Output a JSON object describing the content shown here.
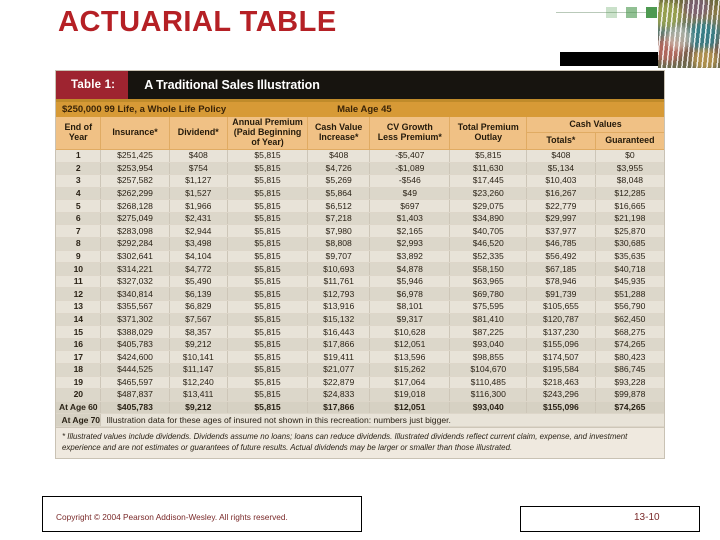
{
  "slide": {
    "title": "ACTUARIAL TABLE",
    "title_color": "#b52025",
    "copyright": "Copyright © 2004 Pearson Addison-Wesley. All rights reserved.",
    "page_number": "13-10"
  },
  "decoration": {
    "squares_color": "#4e9a51",
    "square_count": 3
  },
  "table": {
    "badge": "Table 1:",
    "caption": "A Traditional Sales Illustration",
    "badge_color": "#9e2430",
    "subbar_color": "#d79a36",
    "header_color": "#f0c185",
    "policy": "$250,000 99 Life, a Whole Life Policy",
    "insured": "Male Age 45",
    "columns": [
      "End of Year",
      "Insurance*",
      "Dividend*",
      "Annual Premium (Paid Beginning of Year)",
      "Cash Value Increase*",
      "CV Growth Less Premium*",
      "Total Premium Outlay",
      "Cash Values"
    ],
    "headers": {
      "end_of_year": [
        "End of",
        "Year"
      ],
      "insurance": "Insurance*",
      "dividend": "Dividend*",
      "annual_premium": [
        "Annual Premium",
        "(Paid Beginning",
        "of Year)"
      ],
      "cash_value_increase": [
        "Cash Value",
        "Increase*"
      ],
      "cv_growth": [
        "CV Growth",
        "Less Premium*"
      ],
      "total_premium_outlay": [
        "Total Premium",
        "Outlay"
      ],
      "cash_values_group": "Cash Values",
      "cash_values_totals": "Totals*",
      "cash_values_guaranteed": "Guaranteed"
    },
    "rows": [
      [
        "1",
        "$251,425",
        "$408",
        "$5,815",
        "$408",
        "-$5,407",
        "$5,815",
        "$408",
        "$0"
      ],
      [
        "2",
        "$253,954",
        "$754",
        "$5,815",
        "$4,726",
        "-$1,089",
        "$11,630",
        "$5,134",
        "$3,955"
      ],
      [
        "3",
        "$257,582",
        "$1,127",
        "$5,815",
        "$5,269",
        "-$546",
        "$17,445",
        "$10,403",
        "$8,048"
      ],
      [
        "4",
        "$262,299",
        "$1,527",
        "$5,815",
        "$5,864",
        "$49",
        "$23,260",
        "$16,267",
        "$12,285"
      ],
      [
        "5",
        "$268,128",
        "$1,966",
        "$5,815",
        "$6,512",
        "$697",
        "$29,075",
        "$22,779",
        "$16,665"
      ],
      [
        "6",
        "$275,049",
        "$2,431",
        "$5,815",
        "$7,218",
        "$1,403",
        "$34,890",
        "$29,997",
        "$21,198"
      ],
      [
        "7",
        "$283,098",
        "$2,944",
        "$5,815",
        "$7,980",
        "$2,165",
        "$40,705",
        "$37,977",
        "$25,870"
      ],
      [
        "8",
        "$292,284",
        "$3,498",
        "$5,815",
        "$8,808",
        "$2,993",
        "$46,520",
        "$46,785",
        "$30,685"
      ],
      [
        "9",
        "$302,641",
        "$4,104",
        "$5,815",
        "$9,707",
        "$3,892",
        "$52,335",
        "$56,492",
        "$35,635"
      ],
      [
        "10",
        "$314,221",
        "$4,772",
        "$5,815",
        "$10,693",
        "$4,878",
        "$58,150",
        "$67,185",
        "$40,718"
      ],
      [
        "11",
        "$327,032",
        "$5,490",
        "$5,815",
        "$11,761",
        "$5,946",
        "$63,965",
        "$78,946",
        "$45,935"
      ],
      [
        "12",
        "$340,814",
        "$6,139",
        "$5,815",
        "$12,793",
        "$6,978",
        "$69,780",
        "$91,739",
        "$51,288"
      ],
      [
        "13",
        "$355,567",
        "$6,829",
        "$5,815",
        "$13,916",
        "$8,101",
        "$75,595",
        "$105,655",
        "$56,790"
      ],
      [
        "14",
        "$371,302",
        "$7,567",
        "$5,815",
        "$15,132",
        "$9,317",
        "$81,410",
        "$120,787",
        "$62,450"
      ],
      [
        "15",
        "$388,029",
        "$8,357",
        "$5,815",
        "$16,443",
        "$10,628",
        "$87,225",
        "$137,230",
        "$68,275"
      ],
      [
        "16",
        "$405,783",
        "$9,212",
        "$5,815",
        "$17,866",
        "$12,051",
        "$93,040",
        "$155,096",
        "$74,265"
      ],
      [
        "17",
        "$424,600",
        "$10,141",
        "$5,815",
        "$19,411",
        "$13,596",
        "$98,855",
        "$174,507",
        "$80,423"
      ],
      [
        "18",
        "$444,525",
        "$11,147",
        "$5,815",
        "$21,077",
        "$15,262",
        "$104,670",
        "$195,584",
        "$86,745"
      ],
      [
        "19",
        "$465,597",
        "$12,240",
        "$5,815",
        "$22,879",
        "$17,064",
        "$110,485",
        "$218,463",
        "$93,228"
      ],
      [
        "20",
        "$487,837",
        "$13,411",
        "$5,815",
        "$24,833",
        "$19,018",
        "$116,300",
        "$243,296",
        "$99,878"
      ]
    ],
    "age_row": [
      "At Age 60",
      "$405,783",
      "$9,212",
      "$5,815",
      "$17,866",
      "$12,051",
      "$93,040",
      "$155,096",
      "$74,265"
    ],
    "age70_label": "At Age 70",
    "age70_note": "Illustration data for these ages of insured not shown in this recreation: numbers just bigger.",
    "footnote": "* Illustrated values include dividends. Dividends assume no loans; loans can reduce dividends. Illustrated dividends reflect current claim, expense, and investment experience and are not estimates or guarantees of future results. Actual dividends may be larger or smaller than those illustrated."
  }
}
